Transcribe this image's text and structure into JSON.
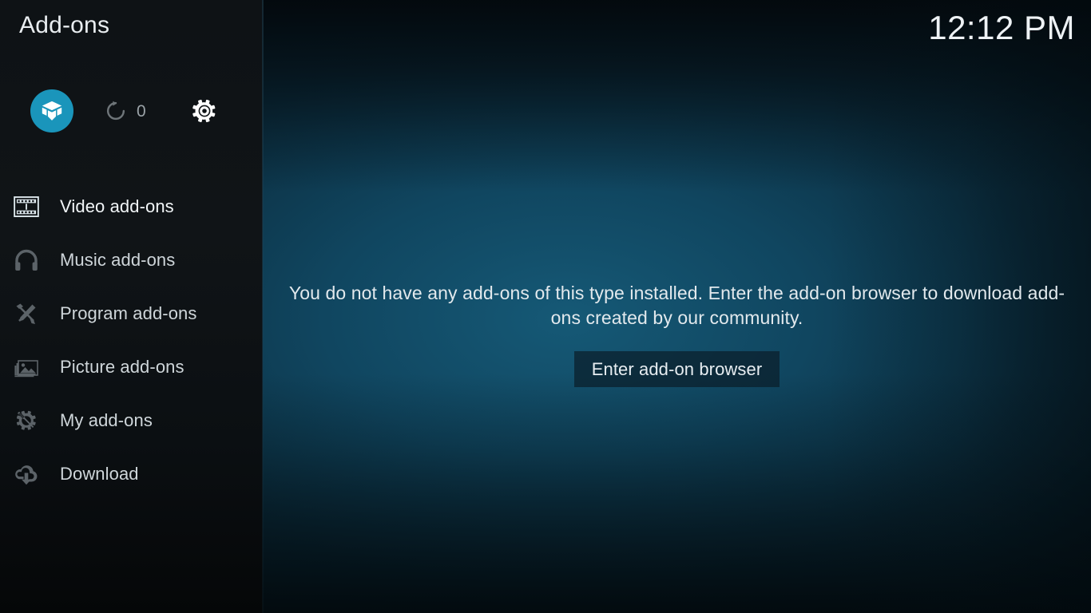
{
  "window": {
    "title": "Add-ons",
    "clock": "12:12 PM"
  },
  "colors": {
    "accent": "#1a95bb",
    "sidebar_bg": "#101417",
    "content_bg": "#11516e",
    "text_primary": "#e9edf0",
    "text_muted": "#9ba3a8",
    "button_bg": "#0a1c28"
  },
  "topbar": {
    "items": [
      {
        "name": "addon-browser",
        "icon": "open-box-icon",
        "label": "",
        "selected": true
      },
      {
        "name": "check-updates",
        "icon": "refresh-icon",
        "label": "0",
        "selected": false
      },
      {
        "name": "addon-settings",
        "icon": "gear-icon",
        "label": "",
        "selected": false
      }
    ]
  },
  "sidebar": {
    "items": [
      {
        "label": "Video add-ons",
        "icon": "film-strip-icon",
        "focused": true
      },
      {
        "label": "Music add-ons",
        "icon": "headphones-icon",
        "focused": false
      },
      {
        "label": "Program add-ons",
        "icon": "pencil-ruler-icon",
        "focused": false
      },
      {
        "label": "Picture add-ons",
        "icon": "photo-stack-icon",
        "focused": false
      },
      {
        "label": "My add-ons",
        "icon": "gear-screwdriver-icon",
        "focused": false
      },
      {
        "label": "Download",
        "icon": "cloud-download-icon",
        "focused": false
      }
    ]
  },
  "main": {
    "empty_message": "You do not have any add-ons of this type installed. Enter the add-on browser to download add-ons created by our community.",
    "enter_browser_label": "Enter add-on browser"
  }
}
